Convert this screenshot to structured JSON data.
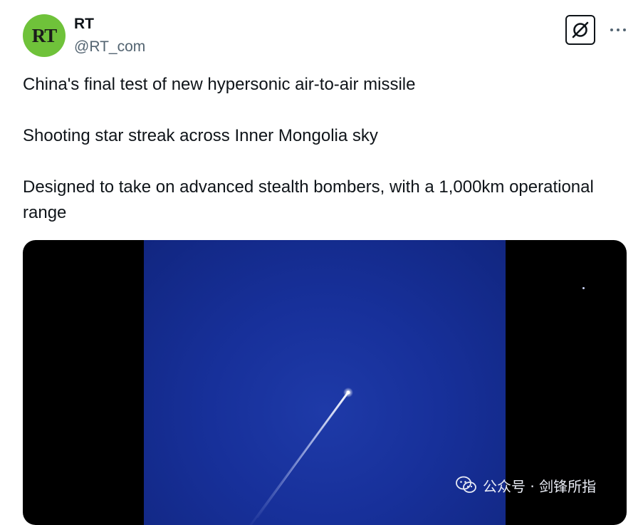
{
  "author": {
    "avatar_text": "RT",
    "display_name": "RT",
    "handle": "@RT_com",
    "avatar_color": "#6fc23a"
  },
  "header_actions": {
    "grok_icon": "grok-icon",
    "more_icon": "more-horizontal-icon"
  },
  "tweet": {
    "paragraphs": [
      "China's final test of new hypersonic air-to-air missile",
      "Shooting star streak across Inner Mongolia sky",
      "Designed to take on advanced stealth bombers, with a 1,000km operational range"
    ]
  },
  "media": {
    "type": "video",
    "description_icon": "missile-streak",
    "sky_color": "#17309a",
    "letterbox_color": "#000000"
  },
  "watermark": {
    "icon": "wechat-icon",
    "text": "公众号 · 剑锋所指"
  }
}
